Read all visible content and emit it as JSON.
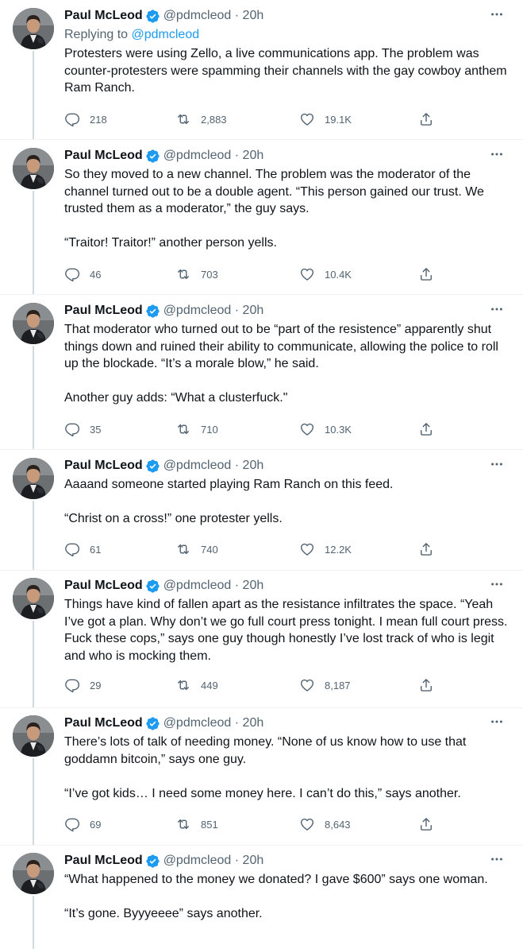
{
  "tweets": [
    {
      "name": "Paul McLeod",
      "handle": "@pdmcleod",
      "sep": "·",
      "time": "20h",
      "replying_label": "Replying to",
      "replying_handle": "@pdmcleod",
      "paragraphs": [
        "Protesters were using Zello, a live communications app. The problem was counter-protesters were spamming their channels with the gay cowboy anthem Ram Ranch."
      ],
      "replies": "218",
      "retweets": "2,883",
      "likes": "19.1K"
    },
    {
      "name": "Paul McLeod",
      "handle": "@pdmcleod",
      "sep": "·",
      "time": "20h",
      "paragraphs": [
        "So they moved to a new channel. The problem was the moderator of the channel turned out to be a double agent. “This person gained our trust. We trusted them as a moderator,” the guy says.",
        "“Traitor! Traitor!” another person yells."
      ],
      "replies": "46",
      "retweets": "703",
      "likes": "10.4K"
    },
    {
      "name": "Paul McLeod",
      "handle": "@pdmcleod",
      "sep": "·",
      "time": "20h",
      "paragraphs": [
        "That moderator who turned out to be “part of the resistence” apparently shut things down and ruined their ability to communicate, allowing the police to roll up the blockade. “It’s a morale blow,” he said.",
        "Another guy adds: “What a clusterfuck.\""
      ],
      "replies": "35",
      "retweets": "710",
      "likes": "10.3K"
    },
    {
      "name": "Paul McLeod",
      "handle": "@pdmcleod",
      "sep": "·",
      "time": "20h",
      "paragraphs": [
        "Aaaand someone started playing Ram Ranch on this feed.",
        "“Christ on a cross!” one protester yells."
      ],
      "replies": "61",
      "retweets": "740",
      "likes": "12.2K"
    },
    {
      "name": "Paul McLeod",
      "handle": "@pdmcleod",
      "sep": "·",
      "time": "20h",
      "paragraphs": [
        "Things have kind of fallen apart as the resistance infiltrates the space. “Yeah I’ve got a plan. Why don’t we go full court press tonight. I mean full court press. Fuck these cops,” says one guy though honestly I’ve lost track of who is legit and who is mocking them."
      ],
      "replies": "29",
      "retweets": "449",
      "likes": "8,187"
    },
    {
      "name": "Paul McLeod",
      "handle": "@pdmcleod",
      "sep": "·",
      "time": "20h",
      "paragraphs": [
        "There’s lots of talk of needing money. “None of us know how to use that goddamn bitcoin,” says one guy.",
        "“I’ve got kids… I need some money here. I can’t do this,” says another."
      ],
      "replies": "69",
      "retweets": "851",
      "likes": "8,643"
    },
    {
      "name": "Paul McLeod",
      "handle": "@pdmcleod",
      "sep": "·",
      "time": "20h",
      "paragraphs": [
        "“What happened to the money we donated? I gave $600” says one woman.",
        "“It’s gone. Byyyeeee” says another."
      ]
    }
  ],
  "colors": {
    "text": "#0f1419",
    "secondary": "#536471",
    "accent": "#1d9bf0",
    "thread_line": "#cfd9de"
  },
  "icons": {
    "verified": "verified-badge-icon",
    "more": "more-options-icon",
    "reply": "reply-icon",
    "retweet": "retweet-icon",
    "like": "heart-icon",
    "share": "share-icon"
  }
}
